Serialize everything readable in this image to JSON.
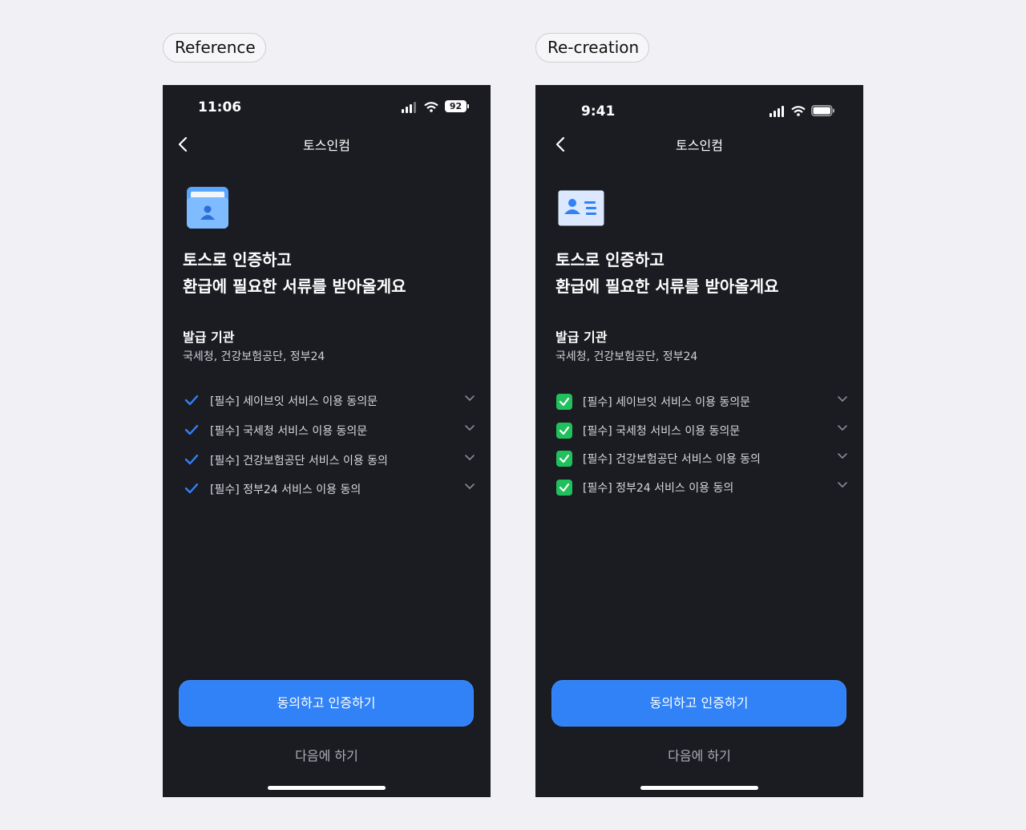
{
  "labels": {
    "reference": "Reference",
    "recreation": "Re-creation"
  },
  "reference": {
    "status": {
      "time": "11:06",
      "battery": "92"
    },
    "nav_title": "토스인컴",
    "heading": [
      "토스로 인증하고",
      "환급에 필요한 서류를 받아올게요"
    ],
    "issuer": {
      "title": "발급 기관",
      "desc": "국세청, 건강보험공단, 정부24"
    },
    "agreements": [
      "[필수] 세이브잇 서비스 이용 동의문",
      "[필수] 국세청 서비스 이용 동의문",
      "[필수] 건강보험공단 서비스 이용 동의",
      "[필수] 정부24 서비스 이용 동의"
    ],
    "cta": "동의하고 인증하기",
    "later": "다음에 하기"
  },
  "recreation": {
    "status": {
      "time": "9:41"
    },
    "nav_title": "토스인컴",
    "heading": [
      "토스로 인증하고",
      "환급에 필요한 서류를 받아올게요"
    ],
    "issuer": {
      "title": "발급 기관",
      "desc": "국세청, 건강보험공단, 정부24"
    },
    "agreements": [
      "[필수] 세이브잇 서비스 이용 동의문",
      "[필수] 국세청 서비스 이용 동의문",
      "[필수] 건강보험공단 서비스 이용 동의",
      "[필수] 정부24 서비스 이용 동의"
    ],
    "cta": "동의하고 인증하기",
    "later": "다음에 하기"
  },
  "colors": {
    "background": "#f1f1f5",
    "phone": "#1b1b22",
    "accent": "#3182f6",
    "check_green": "#20c05c"
  },
  "icons": {
    "reference": [
      "signal-icon",
      "wifi-icon",
      "battery-icon",
      "back-icon",
      "document-folder-icon",
      "checkmark-icon",
      "chevron-down-icon"
    ],
    "recreation": [
      "signal-icon",
      "wifi-icon",
      "battery-icon",
      "back-icon",
      "id-card-icon",
      "checkbox-checked-icon",
      "chevron-down-icon"
    ]
  }
}
